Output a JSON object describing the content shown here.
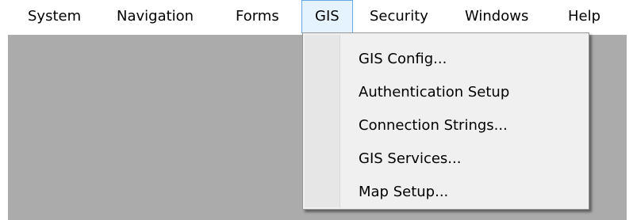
{
  "menubar": {
    "items": [
      {
        "label": "System"
      },
      {
        "label": "Navigation"
      },
      {
        "label": "Forms"
      },
      {
        "label": "GIS"
      },
      {
        "label": "Security"
      },
      {
        "label": "Windows"
      },
      {
        "label": "Help"
      }
    ],
    "active_item": "GIS"
  },
  "gis_menu": {
    "items": [
      {
        "label": "GIS Config..."
      },
      {
        "label": "Authentication Setup"
      },
      {
        "label": "Connection Strings..."
      },
      {
        "label": "GIS Services..."
      },
      {
        "label": "Map Setup..."
      }
    ]
  },
  "colors": {
    "menu_highlight_bg": "#e5f3ff",
    "menu_highlight_border": "#66a7e8",
    "mdi_background": "#ababab",
    "dropdown_bg": "#f0f0f0"
  }
}
